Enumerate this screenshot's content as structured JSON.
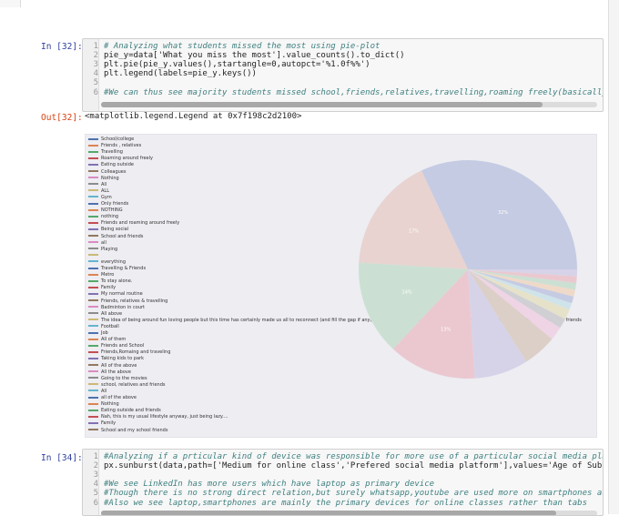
{
  "cells": [
    {
      "prompt": "In [32]:",
      "lines": [
        {
          "n": "1",
          "text": "# Analyzing what students missed the most using pie-plot",
          "comment": true
        },
        {
          "n": "2",
          "text": "pie_y=data['What you miss the most'].value_counts().to_dict()",
          "comment": false
        },
        {
          "n": "3",
          "text": "plt.pie(pie_y.values(),startangle=0,autopct='%1.0f%%')",
          "comment": false
        },
        {
          "n": "4",
          "text": "plt.legend(labels=pie_y.keys())",
          "comment": false
        },
        {
          "n": "5",
          "text": "",
          "comment": false
        },
        {
          "n": "6",
          "text": "#We can thus see majority students missed school,friends,relatives,travelling,roaming freely(basically those f",
          "comment": true
        }
      ]
    },
    {
      "prompt": "In [34]:",
      "lines": [
        {
          "n": "1",
          "text": "#Analyzing if a prticular kind of device was responsible for more use of a particular social media platform",
          "comment": true
        },
        {
          "n": "2",
          "text": "px.sunburst(data,path=['Medium for online class','Prefered social media platform'],values='Age of Subject')",
          "comment": false
        },
        {
          "n": "3",
          "text": "",
          "comment": false
        },
        {
          "n": "4",
          "text": "#We see LinkedIn has more users which have laptop as primary device",
          "comment": true
        },
        {
          "n": "5",
          "text": "#Though there is no strong direct relation,but surely whatsapp,youtube are used more on smartphones as compare",
          "comment": true
        },
        {
          "n": "6",
          "text": "#Also we see laptop,smartphones are mainly the primary devices for online classes rather than tabs",
          "comment": true
        }
      ]
    }
  ],
  "output": {
    "prompt": "Out[32]:",
    "text": "<matplotlib.legend.Legend at 0x7f198c2d2100>"
  },
  "chart_data": {
    "type": "pie",
    "startangle": 0,
    "autopct": "%1.0f%%",
    "legend_position": "upper left",
    "legend": [
      {
        "label": "School/college",
        "color": "#4c72b0"
      },
      {
        "label": "Friends , relatives",
        "color": "#dd8452"
      },
      {
        "label": "Travelling",
        "color": "#55a868"
      },
      {
        "label": "Roaming around freely",
        "color": "#c44e52"
      },
      {
        "label": "Eating outside",
        "color": "#8172b3"
      },
      {
        "label": "Colleagues",
        "color": "#937860"
      },
      {
        "label": "Nothing",
        "color": "#da8bc3"
      },
      {
        "label": "All",
        "color": "#8c8c8c"
      },
      {
        "label": "ALL",
        "color": "#ccb974"
      },
      {
        "label": "Gym",
        "color": "#64b5cd"
      },
      {
        "label": "Only friends",
        "color": "#4c72b0"
      },
      {
        "label": "NOTHING",
        "color": "#dd8452"
      },
      {
        "label": "nothing",
        "color": "#55a868"
      },
      {
        "label": "Friends and roaming around freely",
        "color": "#c44e52"
      },
      {
        "label": "Being social",
        "color": "#8172b3"
      },
      {
        "label": "School and friends",
        "color": "#937860"
      },
      {
        "label": "all",
        "color": "#da8bc3"
      },
      {
        "label": "Playing",
        "color": "#8c8c8c"
      },
      {
        "label": "",
        "color": "#ccb974"
      },
      {
        "label": "everything",
        "color": "#64b5cd"
      },
      {
        "label": "Travelling & Friends",
        "color": "#4c72b0"
      },
      {
        "label": "Metro",
        "color": "#dd8452"
      },
      {
        "label": "To stay alone.",
        "color": "#55a868"
      },
      {
        "label": "Family",
        "color": "#c44e52"
      },
      {
        "label": "My normal routine",
        "color": "#8172b3"
      },
      {
        "label": "Friends, relatives & travelling",
        "color": "#937860"
      },
      {
        "label": "Badminton in court",
        "color": "#da8bc3"
      },
      {
        "label": "All above",
        "color": "#8c8c8c"
      },
      {
        "label": "The idea of being around fun loving people but this time has certainly made us all to reconnect (and fill the gap if any) with our families and relatives so it is fun but certainly we do miss hanging out with friends",
        "color": "#ccb974"
      },
      {
        "label": "Football",
        "color": "#64b5cd"
      },
      {
        "label": "Job",
        "color": "#4c72b0"
      },
      {
        "label": "All of them",
        "color": "#dd8452"
      },
      {
        "label": "Friends and School",
        "color": "#55a868"
      },
      {
        "label": "Friends,Romaing and traveling",
        "color": "#c44e52"
      },
      {
        "label": "Taking kids to park",
        "color": "#8172b3"
      },
      {
        "label": "All of the above",
        "color": "#937860"
      },
      {
        "label": "All the above",
        "color": "#da8bc3"
      },
      {
        "label": "Going to the movies",
        "color": "#8c8c8c"
      },
      {
        "label": "school, relatives and friends",
        "color": "#ccb974"
      },
      {
        "label": "All",
        "color": "#64b5cd"
      },
      {
        "label": "all of the above",
        "color": "#4c72b0"
      },
      {
        "label": "Nothing",
        "color": "#dd8452"
      },
      {
        "label": "Eating outside and friends",
        "color": "#55a868"
      },
      {
        "label": "Nah, this is my usual lifestyle anyway, just being lazy....",
        "color": "#c44e52"
      },
      {
        "label": "Family",
        "color": "#8172b3"
      },
      {
        "label": "School and my school friends",
        "color": "#937860"
      }
    ],
    "slices": [
      {
        "label": "School/college",
        "value": 32,
        "pct_label": "32%",
        "color": "#c5cbe2"
      },
      {
        "label": "Friends , relatives",
        "value": 17,
        "pct_label": "17%",
        "color": "#e8d3d0"
      },
      {
        "label": "Travelling",
        "value": 14,
        "pct_label": "14%",
        "color": "#cbe0d2"
      },
      {
        "label": "Roaming around freely",
        "value": 13,
        "pct_label": "13%",
        "color": "#ebc8d0"
      },
      {
        "label": "Eating outside",
        "value": 8,
        "pct_label": "",
        "color": "#d6d3e8"
      },
      {
        "label": "Colleagues",
        "value": 5,
        "pct_label": "",
        "color": "#dccfc7"
      },
      {
        "label": "Nothing",
        "value": 2,
        "pct_label": "",
        "color": "#efd4e6"
      },
      {
        "label": "All",
        "value": 1.5,
        "pct_label": "",
        "color": "#d0d0d4"
      },
      {
        "label": "ALL",
        "value": 1.5,
        "pct_label": "",
        "color": "#e6e2c9"
      },
      {
        "label": "Gym",
        "value": 1,
        "pct_label": "",
        "color": "#cfe3ea"
      },
      {
        "label": "Only friends",
        "value": 1,
        "pct_label": "",
        "color": "#c5cbe2"
      },
      {
        "label": "NOTHING",
        "value": 1,
        "pct_label": "",
        "color": "#efd9c8"
      },
      {
        "label": "nothing",
        "value": 1,
        "pct_label": "",
        "color": "#cbe0d2"
      },
      {
        "label": "Friends and roaming around freely",
        "value": 1,
        "pct_label": "",
        "color": "#ebc8d0"
      },
      {
        "label": "Being social",
        "value": 1,
        "pct_label": "",
        "color": "#d6d3e8"
      }
    ]
  }
}
